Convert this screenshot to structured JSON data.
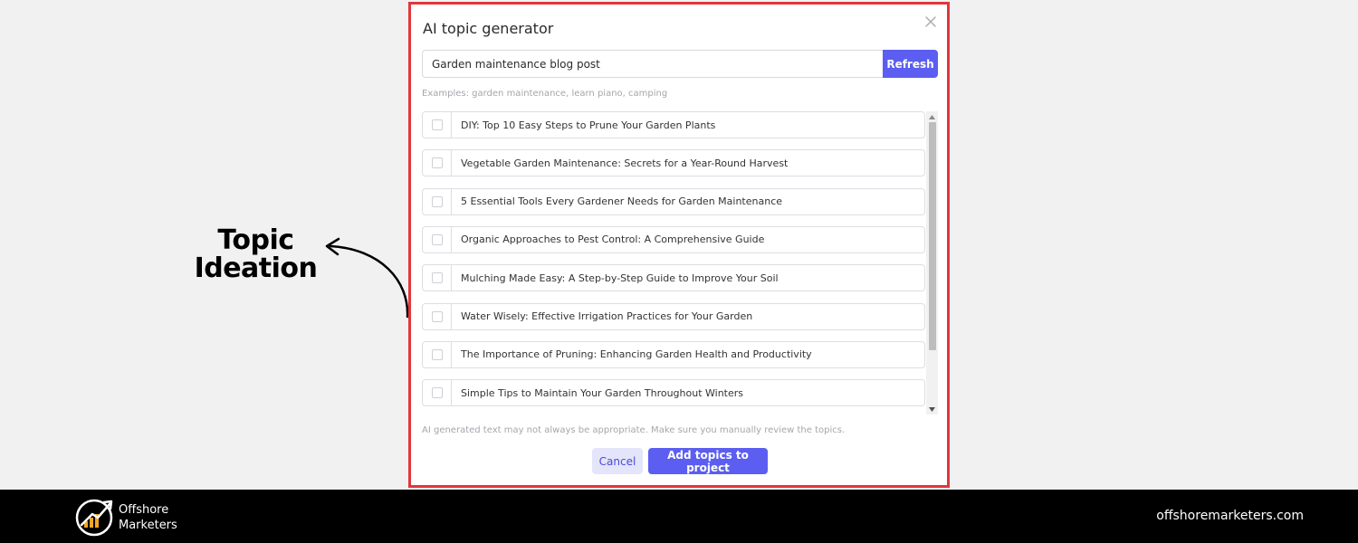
{
  "annotation": {
    "line1": "Topic",
    "line2": "Ideation"
  },
  "modal": {
    "title": "AI topic generator",
    "search": {
      "value": "Garden maintenance blog post",
      "refresh_label": "Refresh"
    },
    "examples": "Examples: garden maintenance, learn piano, camping",
    "topics": [
      "DIY: Top 10 Easy Steps to Prune Your Garden Plants",
      "Vegetable Garden Maintenance: Secrets for a Year-Round Harvest",
      "5 Essential Tools Every Gardener Needs for Garden Maintenance",
      "Organic Approaches to Pest Control: A Comprehensive Guide",
      "Mulching Made Easy: A Step-by-Step Guide to Improve Your Soil",
      "Water Wisely: Effective Irrigation Practices for Your Garden",
      "The Importance of Pruning: Enhancing Garden Health and Productivity",
      "Simple Tips to Maintain Your Garden Throughout Winters"
    ],
    "disclaimer": "AI generated text may not always be appropriate. Make sure you manually review the topics.",
    "cancel_label": "Cancel",
    "add_label": "Add topics to project"
  },
  "footer": {
    "brand_line1": "Offshore",
    "brand_line2": "Marketers",
    "website": "offshoremarketers.com"
  },
  "colors": {
    "accent": "#5b5ef0",
    "highlight_border": "#e2363c",
    "logo_orange": "#f5a623"
  }
}
